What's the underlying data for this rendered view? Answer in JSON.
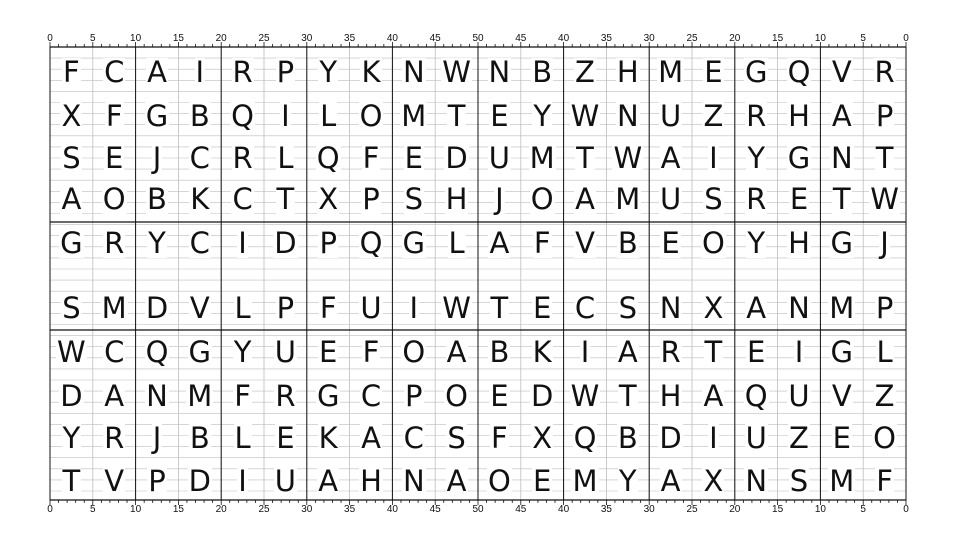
{
  "ruler": {
    "top": [
      "0",
      "5",
      "10",
      "15",
      "20",
      "25",
      "30",
      "35",
      "40",
      "45",
      "50",
      "45",
      "40",
      "35",
      "30",
      "25",
      "20",
      "15",
      "10",
      "5",
      "0"
    ],
    "bottom": [
      "0",
      "5",
      "10",
      "15",
      "20",
      "25",
      "30",
      "35",
      "40",
      "45",
      "50",
      "45",
      "40",
      "35",
      "30",
      "25",
      "20",
      "15",
      "10",
      "5",
      "0"
    ]
  },
  "grid": {
    "rows": [
      [
        "F",
        "C",
        "A",
        "I",
        "R",
        "P",
        "Y",
        "K",
        "N",
        "W",
        "N",
        "B",
        "Z",
        "H",
        "M",
        "E",
        "G",
        "Q",
        "V",
        "R"
      ],
      [
        "X",
        "F",
        "G",
        "B",
        "Q",
        "I",
        "L",
        "O",
        "M",
        "T",
        "E",
        "Y",
        "W",
        "N",
        "U",
        "Z",
        "R",
        "H",
        "A",
        "P"
      ],
      [
        "S",
        "E",
        "J",
        "C",
        "R",
        "L",
        "Q",
        "F",
        "E",
        "D",
        "U",
        "M",
        "T",
        "W",
        "A",
        "I",
        "Y",
        "G",
        "N",
        "T"
      ],
      [
        "A",
        "O",
        "B",
        "K",
        "C",
        "T",
        "X",
        "P",
        "S",
        "H",
        "J",
        "O",
        "A",
        "M",
        "U",
        "S",
        "R",
        "E",
        "T",
        "W"
      ],
      [
        "G",
        "R",
        "Y",
        "C",
        "I",
        "D",
        "P",
        "Q",
        "G",
        "L",
        "A",
        "F",
        "V",
        "B",
        "E",
        "O",
        "Y",
        "H",
        "G",
        "J"
      ],
      [
        "S",
        "M",
        "D",
        "V",
        "L",
        "P",
        "F",
        "U",
        "I",
        "W",
        "T",
        "E",
        "C",
        "S",
        "N",
        "X",
        "A",
        "N",
        "M",
        "P"
      ],
      [
        "W",
        "C",
        "Q",
        "G",
        "Y",
        "U",
        "E",
        "F",
        "O",
        "A",
        "B",
        "K",
        "I",
        "A",
        "R",
        "T",
        "E",
        "I",
        "G",
        "L"
      ],
      [
        "D",
        "A",
        "N",
        "M",
        "F",
        "R",
        "G",
        "C",
        "P",
        "O",
        "E",
        "D",
        "W",
        "T",
        "H",
        "A",
        "Q",
        "U",
        "V",
        "Z"
      ],
      [
        "Y",
        "R",
        "J",
        "B",
        "L",
        "E",
        "K",
        "A",
        "C",
        "S",
        "F",
        "X",
        "Q",
        "B",
        "D",
        "I",
        "U",
        "Z",
        "E",
        "O"
      ],
      [
        "T",
        "V",
        "P",
        "D",
        "I",
        "U",
        "A",
        "H",
        "N",
        "A",
        "O",
        "E",
        "M",
        "Y",
        "A",
        "X",
        "N",
        "S",
        "M",
        "F"
      ]
    ]
  },
  "colors": {
    "ink": "#111111",
    "minor_grid": "#bdbdbd",
    "major_grid": "#111111"
  }
}
